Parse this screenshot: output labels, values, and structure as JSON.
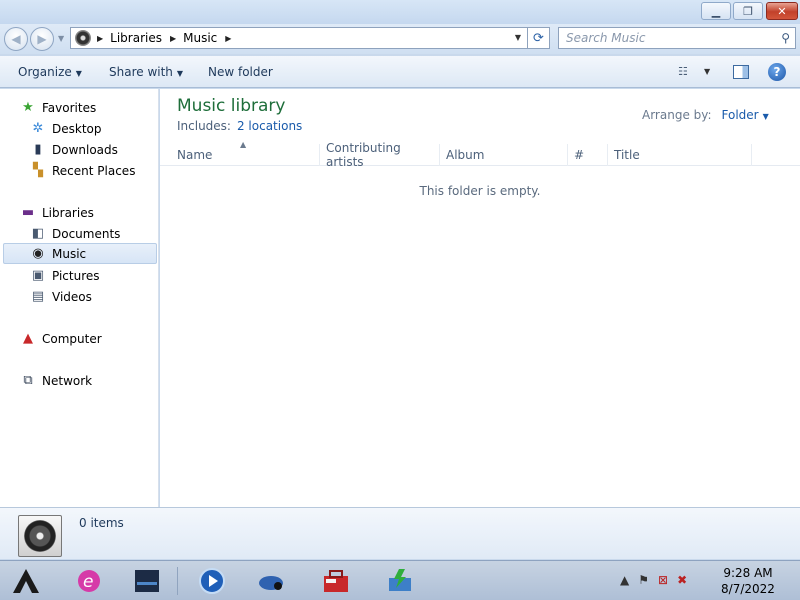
{
  "window": {
    "minimize_icon": "minimize-icon",
    "maximize_icon": "restore-icon",
    "close_icon": "close-icon"
  },
  "address": {
    "breadcrumbs": [
      "Libraries",
      "Music"
    ],
    "search_placeholder": "Search Music"
  },
  "toolbar": {
    "organize": "Organize",
    "share_with": "Share with",
    "new_folder": "New folder"
  },
  "nav": {
    "favorites": "Favorites",
    "desktop": "Desktop",
    "downloads": "Downloads",
    "recent_places": "Recent Places",
    "libraries": "Libraries",
    "documents": "Documents",
    "music": "Music",
    "pictures": "Pictures",
    "videos": "Videos",
    "computer": "Computer",
    "network": "Network"
  },
  "main": {
    "title": "Music library",
    "includes_label": "Includes:",
    "includes_link": "2 locations",
    "arrange_label": "Arrange by:",
    "arrange_value": "Folder",
    "columns": [
      "Name",
      "Contributing artists",
      "Album",
      "#",
      "Title"
    ],
    "empty_message": "This folder is empty."
  },
  "details": {
    "item_count": "0 items"
  },
  "taskbar": {
    "time": "9:28 AM",
    "date": "8/7/2022"
  },
  "colors": {
    "library_title": "#1e6e3a",
    "link": "#1a5bab",
    "close_button": "#c2412a"
  }
}
